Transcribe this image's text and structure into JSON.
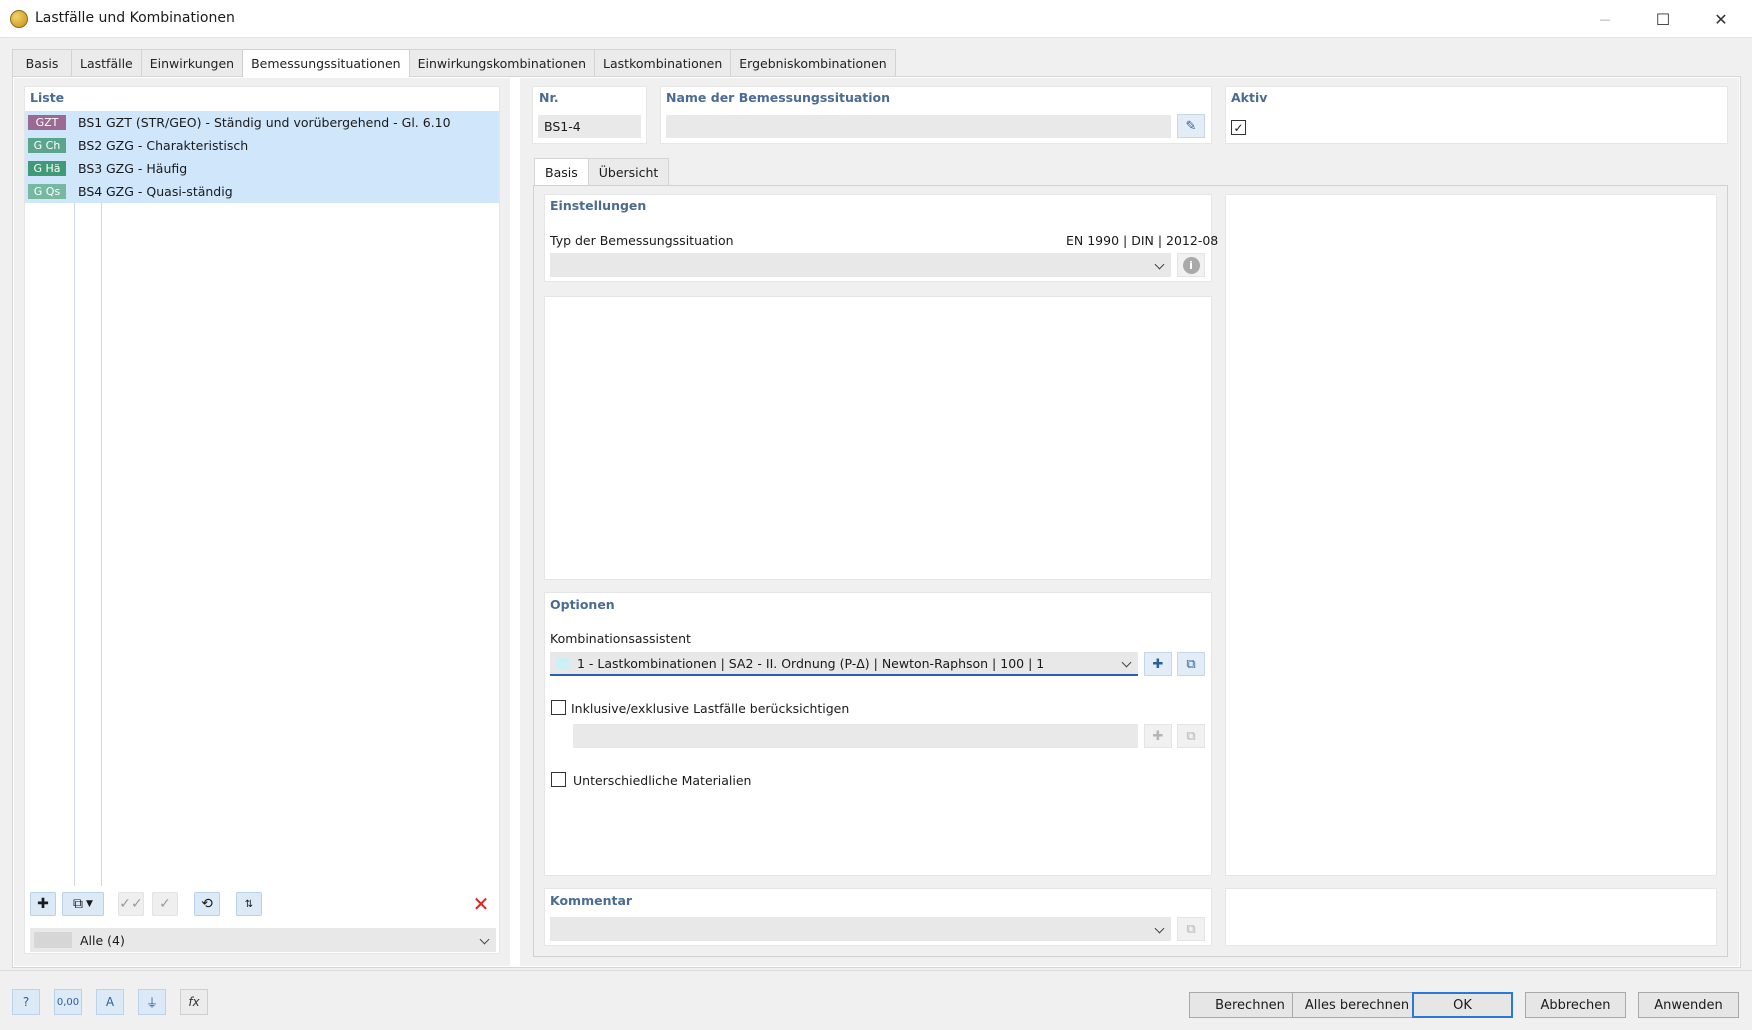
{
  "window": {
    "title": "Lastfälle und Kombinationen",
    "minimize_glyph": "—",
    "maximize_glyph": "☐",
    "close_glyph": "✕"
  },
  "tabs": [
    {
      "label": "Basis"
    },
    {
      "label": "Lastfälle"
    },
    {
      "label": "Einwirkungen"
    },
    {
      "label": "Bemessungssituationen",
      "active": true
    },
    {
      "label": "Einwirkungskombinationen"
    },
    {
      "label": "Lastkombinationen"
    },
    {
      "label": "Ergebniskombinationen"
    }
  ],
  "list": {
    "title": "Liste",
    "items": [
      {
        "badge": "GZT",
        "badge_color": "#9b6a92",
        "id": "BS1",
        "text": "GZT (STR/GEO) - Ständig und vorübergehend - Gl. 6.10"
      },
      {
        "badge": "G Ch",
        "badge_color": "#5ba58c",
        "id": "BS2",
        "text": "GZG - Charakteristisch"
      },
      {
        "badge": "G Hä",
        "badge_color": "#3f9a78",
        "id": "BS3",
        "text": "GZG - Häufig"
      },
      {
        "badge": "G Qs",
        "badge_color": "#76b9a0",
        "id": "BS4",
        "text": "GZG - Quasi-ständig"
      }
    ],
    "filter_value": "Alle (4)",
    "toolbar_icons": [
      "new-item-icon",
      "copy-item-icon",
      "check-all-icon",
      "uncheck-all-icon",
      "renumber-icon",
      "sort-number-icon",
      "delete-icon"
    ]
  },
  "header": {
    "nr_label": "Nr.",
    "nr_value": "BS1-4",
    "name_label": "Name der Bemessungssituation",
    "name_value": "",
    "active_label": "Aktiv"
  },
  "subtabs": [
    {
      "label": "Basis",
      "active": true
    },
    {
      "label": "Übersicht"
    }
  ],
  "einstellungen": {
    "title": "Einstellungen",
    "type_label": "Typ der Bemessungssituation",
    "norm": "EN 1990 | DIN | 2012-08",
    "type_value": ""
  },
  "optionen": {
    "title": "Optionen",
    "wizard_label": "Kombinationsassistent",
    "wizard_value": "1 - Lastkombinationen | SA2 - II. Ordnung (P-Δ) | Newton-Raphson | 100 | 1",
    "wizard_color": "#cdeff5",
    "inclusive_label": "Inklusive/exklusive Lastfälle berücksichtigen",
    "inclusive_value": "",
    "materials_label": "Unterschiedliche Materialien"
  },
  "kommentar": {
    "title": "Kommentar",
    "value": ""
  },
  "footer": {
    "buttons": {
      "calc": "Berechnen",
      "calc_all": "Alles berechnen",
      "ok": "OK",
      "cancel": "Abbrechen",
      "apply": "Anwenden"
    },
    "icon_labels": {
      "units": "0,00"
    }
  }
}
